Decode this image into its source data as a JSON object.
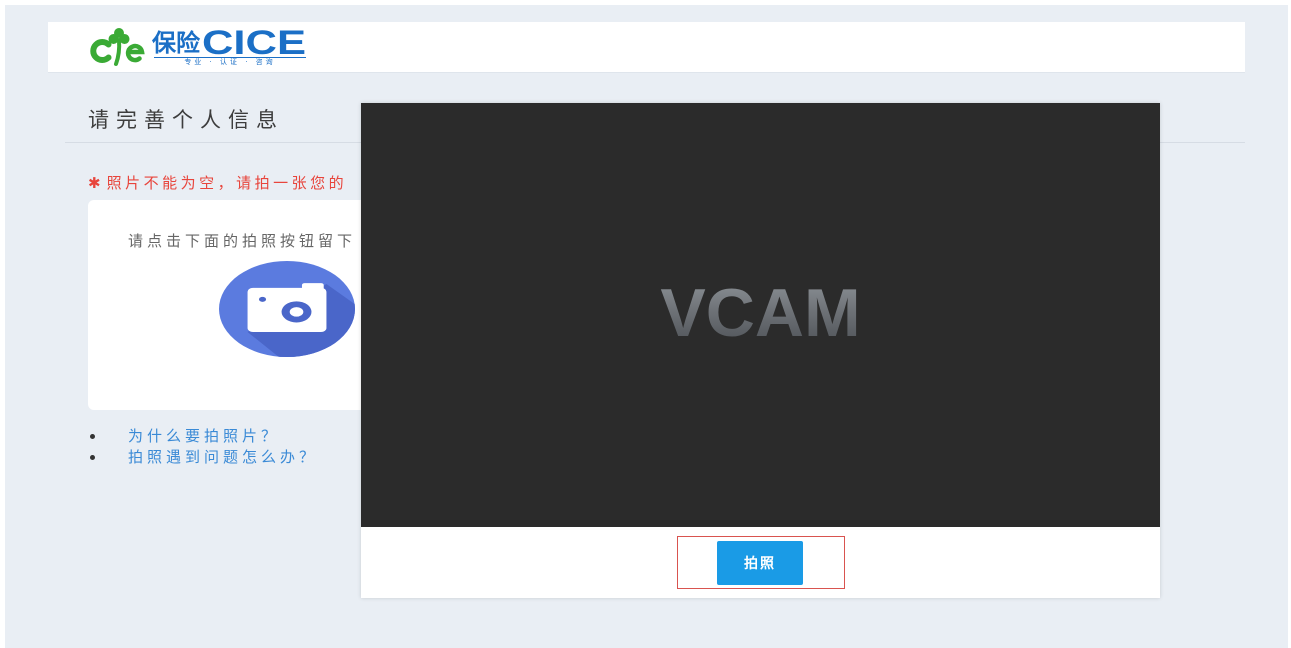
{
  "header": {
    "logo": {
      "name_cn": "保险",
      "name_en": "CICE",
      "tagline": "专业 · 认证 · 咨询",
      "icon": "cice-clover-logo-icon"
    }
  },
  "page": {
    "title": "请完善个人信息"
  },
  "notice": {
    "marker": "✱",
    "text": "照片不能为空，请拍一张您的"
  },
  "photo_card": {
    "instruction": "请点击下面的拍照按钮留下",
    "icon": "camera-icon"
  },
  "help_links": [
    {
      "label": "为什么要拍照片？"
    },
    {
      "label": "拍照遇到问题怎么办？"
    }
  ],
  "camera_modal": {
    "preview_label": "VCAM",
    "capture_button_label": "拍照"
  },
  "colors": {
    "page_background": "#e9eef4",
    "brand_blue": "#1b6fc6",
    "logo_green": "#3aaa35",
    "notice_red": "#e8453c",
    "link_blue": "#3a8ad6",
    "camera_icon_blue": "#5b7bdf",
    "camera_icon_shadow": "#4a66c9",
    "preview_background": "#2b2b2b",
    "capture_button_blue": "#1a9be6",
    "highlight_red": "#d9534f"
  }
}
